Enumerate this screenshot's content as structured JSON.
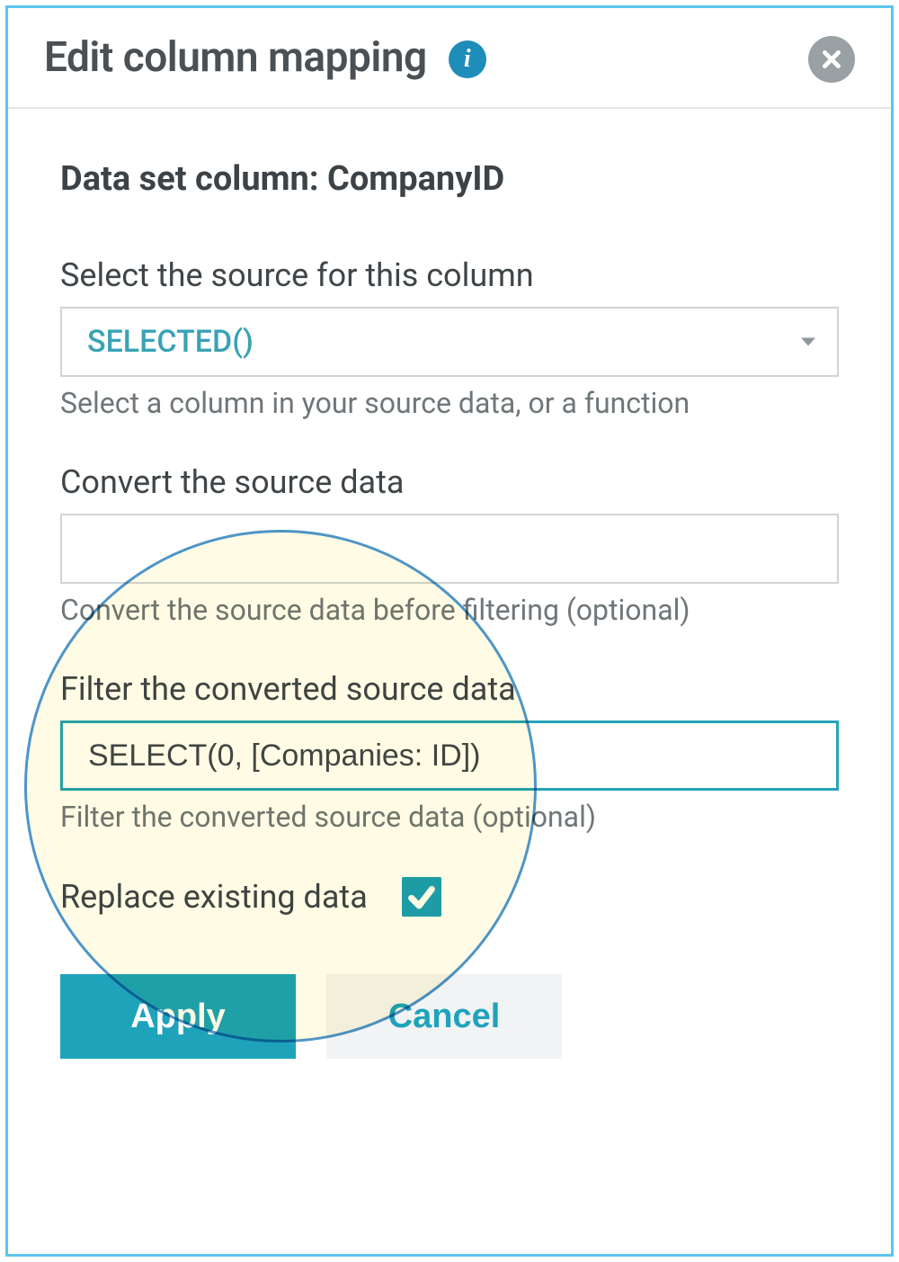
{
  "header": {
    "title": "Edit column mapping"
  },
  "body": {
    "column_heading": "Data set column: CompanyID",
    "source": {
      "label": "Select the source for this column",
      "value": "SELECTED()",
      "help": "Select a column in your source data, or a function"
    },
    "convert": {
      "label": "Convert the source data",
      "value": "",
      "help": "Convert the source data before filtering (optional)"
    },
    "filter": {
      "label": "Filter the converted source data",
      "value": "SELECT(0, [Companies: ID])",
      "help": "Filter the converted source data (optional)"
    },
    "replace": {
      "label": "Replace existing data",
      "checked": true
    },
    "buttons": {
      "apply": "Apply",
      "cancel": "Cancel"
    }
  },
  "colors": {
    "accent": "#1fa3bb",
    "border_focus": "#27a3b8",
    "dialog_border": "#5dc4ee",
    "info_bg": "#1e8db9",
    "close_bg": "#9aa1a5",
    "highlight_border": "#4e95c6"
  }
}
